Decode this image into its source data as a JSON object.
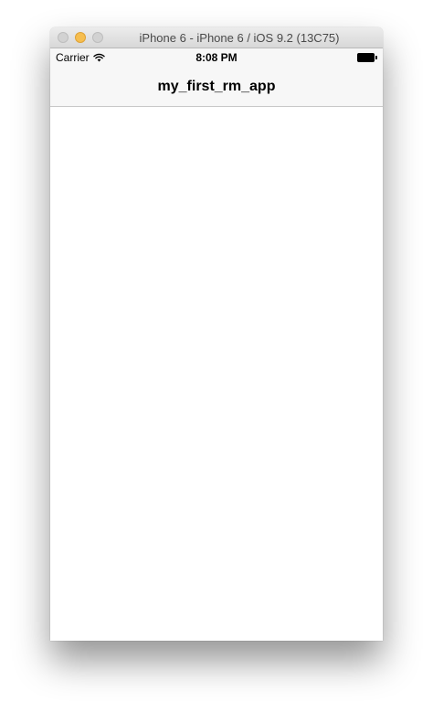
{
  "window": {
    "title": "iPhone 6 - iPhone 6 / iOS 9.2 (13C75)",
    "buttons": [
      "close",
      "minimize",
      "zoom"
    ],
    "accent": "#f6be4f"
  },
  "statusbar": {
    "carrier": "Carrier",
    "signal_icon": "wifi-icon",
    "time": "8:08 PM",
    "battery_icon": "battery-icon",
    "battery_level": 1.0
  },
  "navbar": {
    "title": "my_first_rm_app"
  }
}
